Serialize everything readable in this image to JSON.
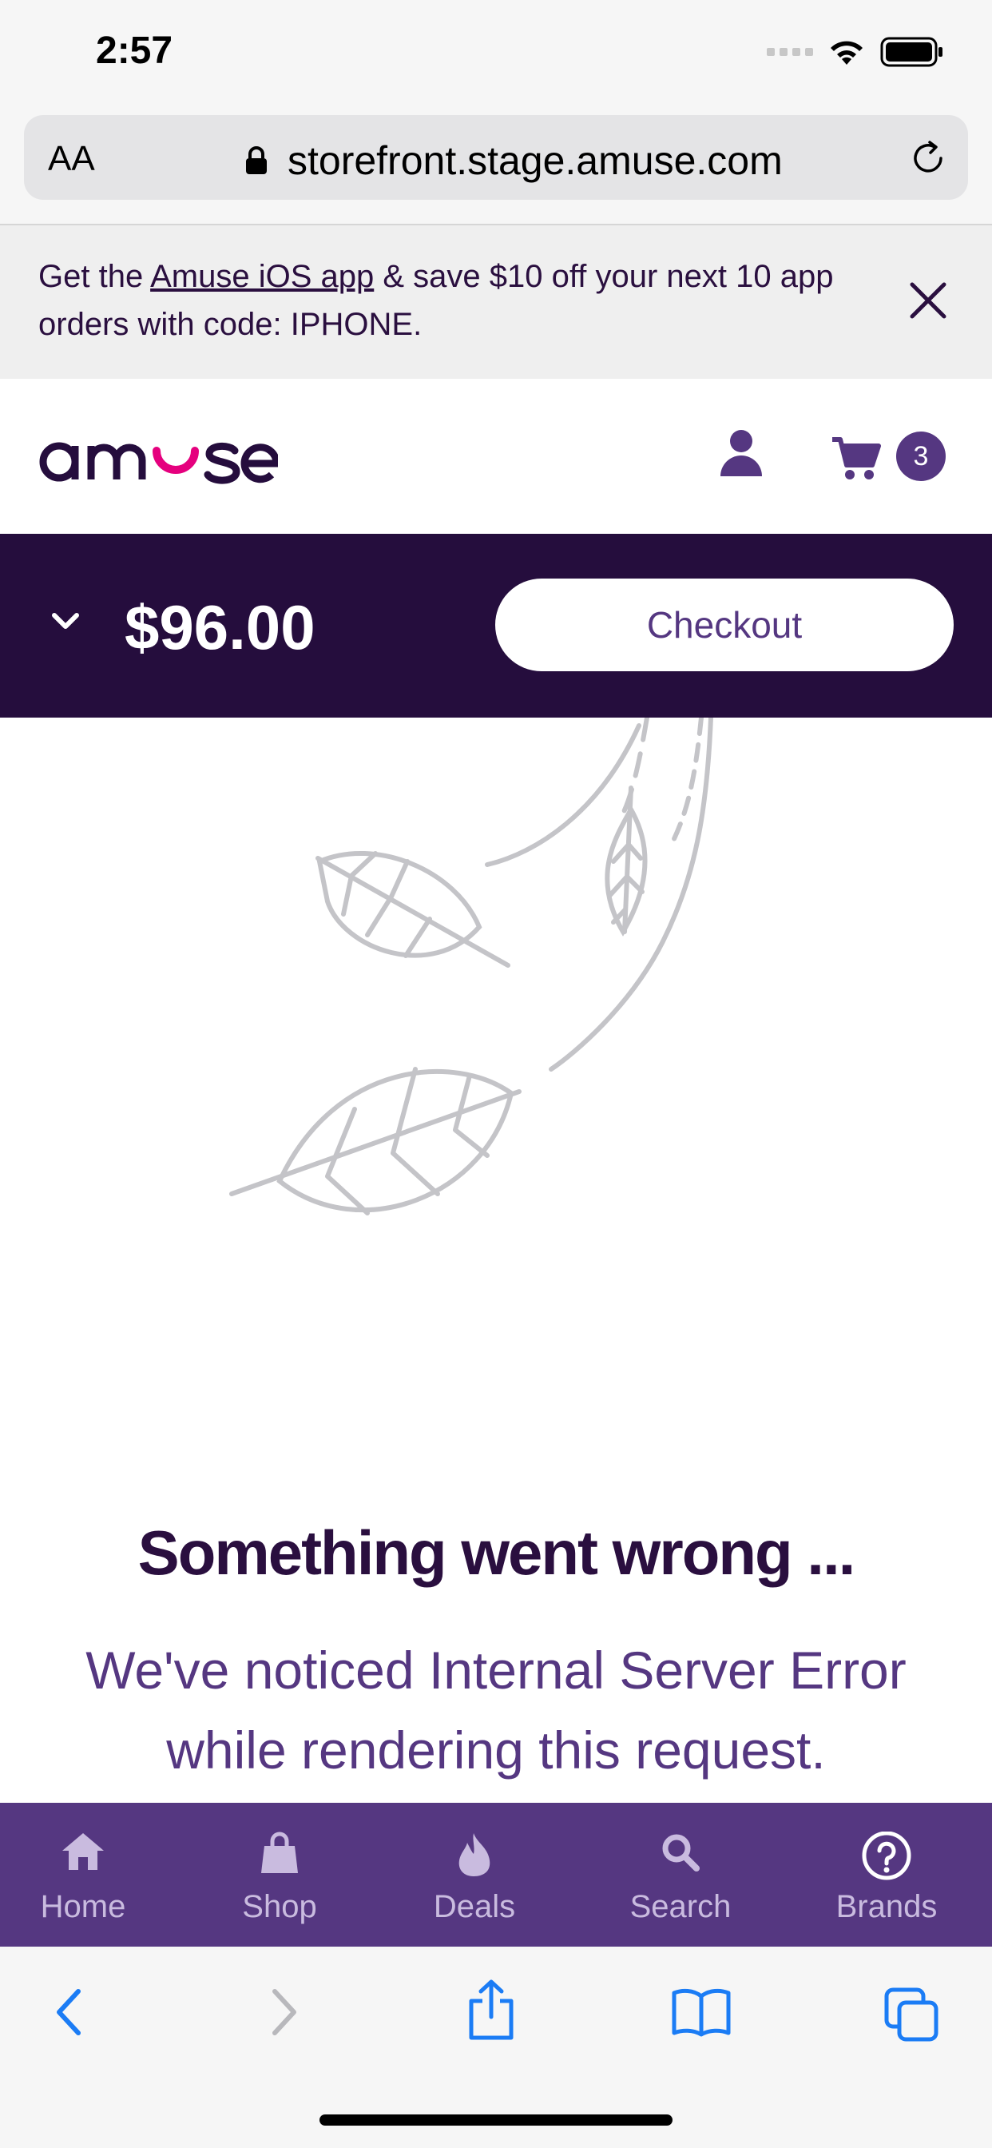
{
  "status": {
    "time": "2:57"
  },
  "browser": {
    "aa_label": "AA",
    "url": "storefront.stage.amuse.com"
  },
  "promo": {
    "text_before": "Get the ",
    "link_text": "Amuse iOS app",
    "text_after": " & save $10 off your next 10 app orders with code: IPHONE."
  },
  "header": {
    "cart_count": "3"
  },
  "cartbar": {
    "total": "$96.00",
    "checkout_label": "Checkout"
  },
  "error": {
    "title": "Something went wrong ...",
    "message": "We've noticed Internal Server Error while rendering this request."
  },
  "tabs": [
    {
      "label": "Home",
      "icon": "home-icon"
    },
    {
      "label": "Shop",
      "icon": "bag-icon"
    },
    {
      "label": "Deals",
      "icon": "flame-icon"
    },
    {
      "label": "Search",
      "icon": "search-icon"
    },
    {
      "label": "Brands",
      "icon": "help-icon"
    }
  ],
  "colors": {
    "brand_purple": "#553781",
    "dark_purple": "#250d3d",
    "accent_pink": "#e5007e"
  }
}
